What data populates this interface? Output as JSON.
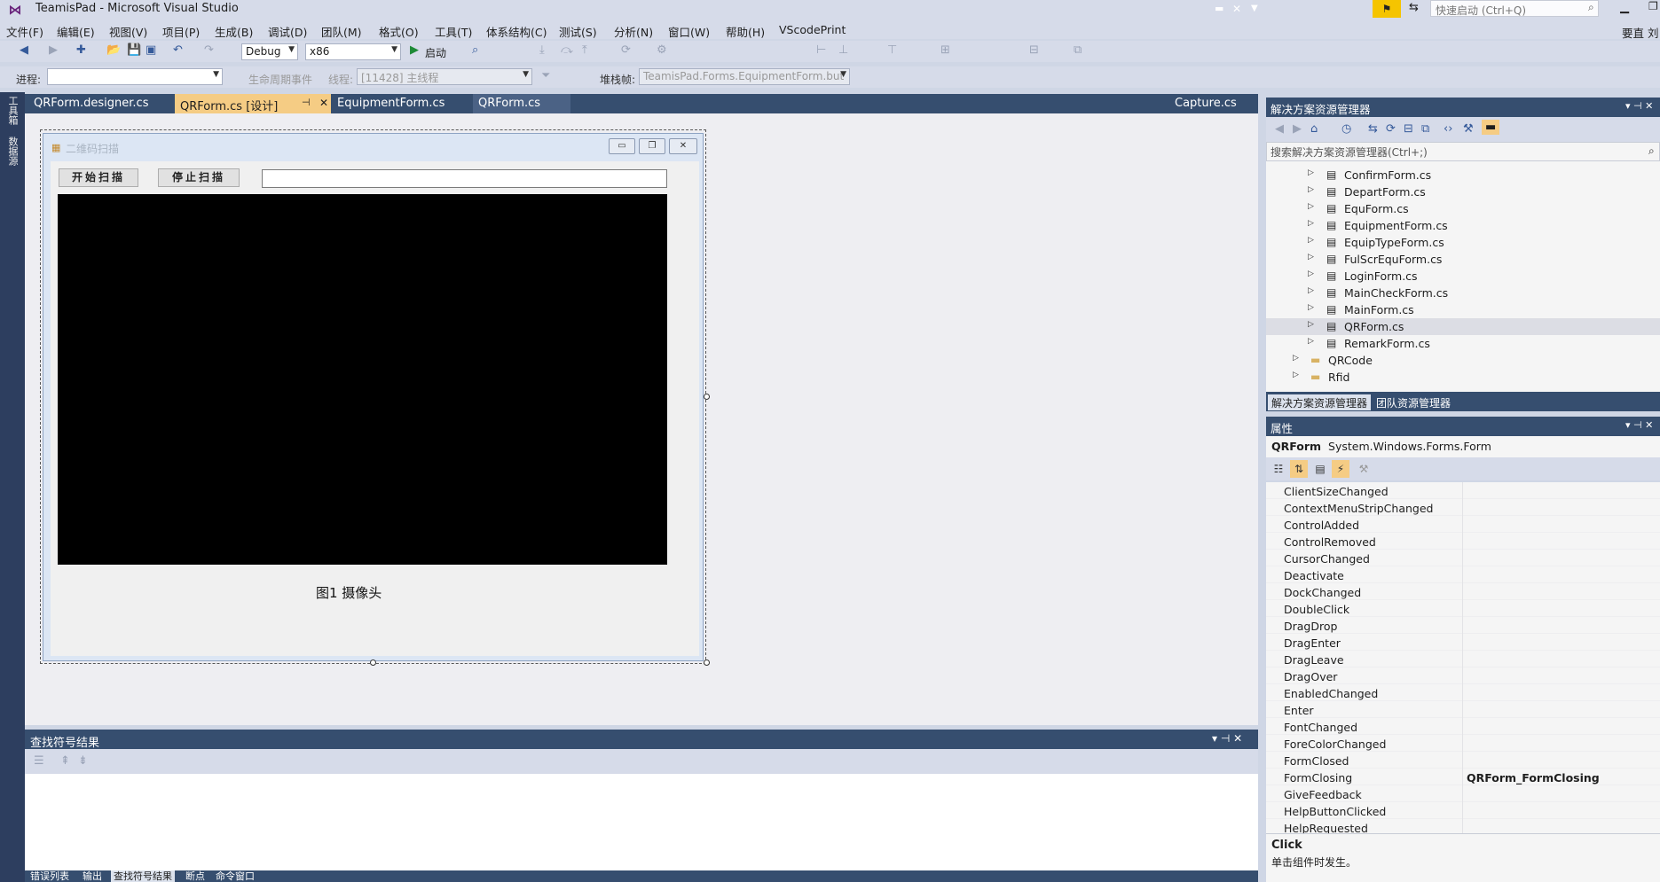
{
  "window": {
    "title": "TeamisPad - Microsoft Visual Studio",
    "quick_launch_placeholder": "快速启动 (Ctrl+Q)",
    "user": "要直 刘"
  },
  "menu": [
    "文件(F)",
    "编辑(E)",
    "视图(V)",
    "项目(P)",
    "生成(B)",
    "调试(D)",
    "团队(M)",
    "格式(O)",
    "工具(T)",
    "体系结构(C)",
    "测试(S)",
    "分析(N)",
    "窗口(W)",
    "帮助(H)",
    "VScodePrint"
  ],
  "toolbar": {
    "config": "Debug",
    "platform": "x86",
    "start_label": "启动"
  },
  "toolbar2": {
    "process_label": "进程:",
    "lifecycle_label": "生命周期事件",
    "thread_label": "线程:",
    "thread_value": "[11428] 主线程",
    "stack_label": "堆栈帧:",
    "stack_value": "TeamisPad.Forms.EquipmentForm.but"
  },
  "left_strip": [
    "工具箱",
    "数据源"
  ],
  "doc_tabs": [
    {
      "label": "QRForm.designer.cs",
      "active": false
    },
    {
      "label": "QRForm.cs [设计]",
      "active": true
    },
    {
      "label": "EquipmentForm.cs",
      "active": false
    },
    {
      "label": "QRForm.cs",
      "active": false
    }
  ],
  "capture_tab": "Capture.cs",
  "designer_form": {
    "title": "二维码扫描",
    "start_button": "开始扫描",
    "stop_button": "停止扫描",
    "caption": "图1 摄像头"
  },
  "find_panel": {
    "title": "查找符号结果"
  },
  "bottom_tabs": [
    "错误列表",
    "输出",
    "查找符号结果",
    "断点",
    "命令窗口"
  ],
  "solution_explorer": {
    "title": "解决方案资源管理器",
    "search_placeholder": "搜索解决方案资源管理器(Ctrl+;)",
    "items": [
      {
        "label": "ConfirmForm.cs",
        "type": "file",
        "selected": false
      },
      {
        "label": "DepartForm.cs",
        "type": "file",
        "selected": false
      },
      {
        "label": "EquForm.cs",
        "type": "file",
        "selected": false
      },
      {
        "label": "EquipmentForm.cs",
        "type": "file",
        "selected": false
      },
      {
        "label": "EquipTypeForm.cs",
        "type": "file",
        "selected": false
      },
      {
        "label": "FulScrEquForm.cs",
        "type": "file",
        "selected": false
      },
      {
        "label": "LoginForm.cs",
        "type": "file",
        "selected": false
      },
      {
        "label": "MainCheckForm.cs",
        "type": "file",
        "selected": false
      },
      {
        "label": "MainForm.cs",
        "type": "file",
        "selected": false
      },
      {
        "label": "QRForm.cs",
        "type": "file",
        "selected": true
      },
      {
        "label": "RemarkForm.cs",
        "type": "file",
        "selected": false
      },
      {
        "label": "QRCode",
        "type": "folder",
        "selected": false
      },
      {
        "label": "Rfid",
        "type": "folder",
        "selected": false
      }
    ],
    "tabs": [
      "解决方案资源管理器",
      "团队资源管理器"
    ]
  },
  "properties": {
    "title": "属性",
    "object_name": "QRForm",
    "object_type": "System.Windows.Forms.Form",
    "rows": [
      {
        "name": "ClientSizeChanged",
        "value": ""
      },
      {
        "name": "ContextMenuStripChanged",
        "value": ""
      },
      {
        "name": "ControlAdded",
        "value": ""
      },
      {
        "name": "ControlRemoved",
        "value": ""
      },
      {
        "name": "CursorChanged",
        "value": ""
      },
      {
        "name": "Deactivate",
        "value": ""
      },
      {
        "name": "DockChanged",
        "value": ""
      },
      {
        "name": "DoubleClick",
        "value": ""
      },
      {
        "name": "DragDrop",
        "value": ""
      },
      {
        "name": "DragEnter",
        "value": ""
      },
      {
        "name": "DragLeave",
        "value": ""
      },
      {
        "name": "DragOver",
        "value": ""
      },
      {
        "name": "EnabledChanged",
        "value": ""
      },
      {
        "name": "Enter",
        "value": ""
      },
      {
        "name": "FontChanged",
        "value": ""
      },
      {
        "name": "ForeColorChanged",
        "value": ""
      },
      {
        "name": "FormClosed",
        "value": ""
      },
      {
        "name": "FormClosing",
        "value": "QRForm_FormClosing"
      },
      {
        "name": "GiveFeedback",
        "value": ""
      },
      {
        "name": "HelpButtonClicked",
        "value": ""
      },
      {
        "name": "HelpRequested",
        "value": ""
      }
    ],
    "desc_title": "Click",
    "desc_text": "单击组件时发生。"
  }
}
